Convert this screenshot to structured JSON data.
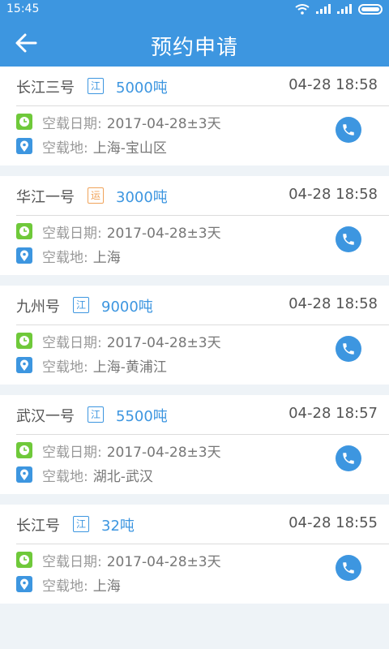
{
  "statusbar": {
    "time": "15:45"
  },
  "appbar": {
    "title": "预约申请"
  },
  "labels": {
    "date": "空载日期:",
    "place": "空载地:"
  },
  "colors": {
    "primary": "#3d96e0",
    "green": "#6fc93a",
    "orange": "#f0a35a"
  },
  "cards": [
    {
      "name": "长江三号",
      "tag": "江",
      "tonnage": "5000吨",
      "time": "04-28 18:58",
      "date": "2017-04-28±3天",
      "place": "上海-宝山区"
    },
    {
      "name": "华江一号",
      "tag": "运",
      "tonnage": "3000吨",
      "time": "04-28 18:58",
      "date": "2017-04-28±3天",
      "place": "上海"
    },
    {
      "name": "九州号",
      "tag": "江",
      "tonnage": "9000吨",
      "time": "04-28 18:58",
      "date": "2017-04-28±3天",
      "place": "上海-黄浦江"
    },
    {
      "name": "武汉一号",
      "tag": "江",
      "tonnage": "5500吨",
      "time": "04-28 18:57",
      "date": "2017-04-28±3天",
      "place": "湖北-武汉"
    },
    {
      "name": "长江号",
      "tag": "江",
      "tonnage": "32吨",
      "time": "04-28 18:55",
      "date": "2017-04-28±3天",
      "place": "上海"
    }
  ]
}
